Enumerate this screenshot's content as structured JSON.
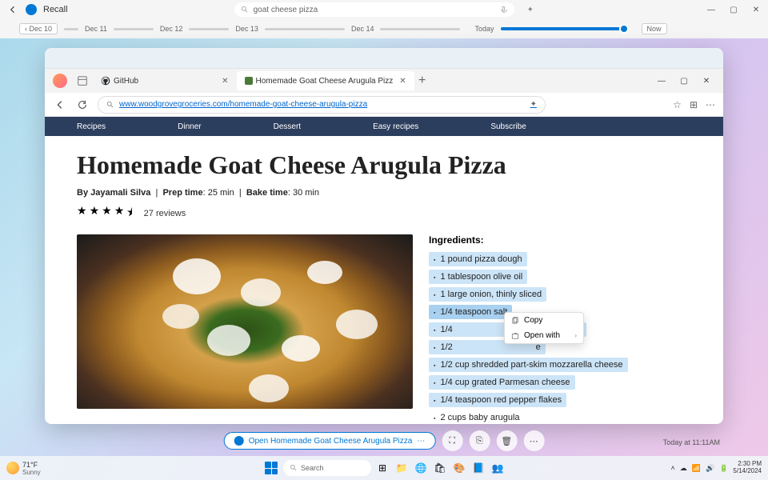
{
  "recall": {
    "title": "Recall",
    "search_value": "goat cheese pizza"
  },
  "timeline": {
    "back_label": "Dec 10",
    "dates": [
      "Dec 11",
      "Dec 12",
      "Dec 13",
      "Dec 14"
    ],
    "today_label": "Today",
    "now_label": "Now"
  },
  "browser": {
    "tabs": [
      {
        "label": "GitHub"
      },
      {
        "label": "Homemade Goat Cheese Arugula Pizz"
      }
    ],
    "url": "www.woodgrovegroceries.com/homemade-goat-cheese-arugula-pizza"
  },
  "site_nav": [
    "Recipes",
    "Dinner",
    "Dessert",
    "Easy recipes",
    "Subscribe"
  ],
  "recipe": {
    "title": "Homemade Goat Cheese Arugula Pizza",
    "author_prefix": "By ",
    "author": "Jayamali Silva",
    "prep_label": "Prep time",
    "prep_value": "25 min",
    "bake_label": "Bake time",
    "bake_value": "30 min",
    "reviews": "27 reviews",
    "ingredients_label": "Ingredients:",
    "ingredients": [
      "1 pound pizza dough",
      "1 tablespoon olive oil",
      "1 large onion, thinly sliced",
      "1/4 teaspoon salt",
      "1/4 teaspoon coarsely ground black pepper",
      "1/2 cup crumbled goat cheese",
      "1/2 cup shredded part-skim mozzarella cheese",
      "1/4 cup grated Parmesan cheese",
      "1/4 teaspoon red pepper flakes",
      "2 cups baby arugula"
    ]
  },
  "context_menu": {
    "copy": "Copy",
    "open_with": "Open with"
  },
  "action": {
    "open_label": "Open Homemade Goat Cheese Arugula Pizza",
    "timestamp": "Today at 11:11AM"
  },
  "taskbar": {
    "weather_temp": "71°F",
    "weather_cond": "Sunny",
    "search_label": "Search",
    "time": "2:30 PM",
    "date": "5/14/2024"
  }
}
